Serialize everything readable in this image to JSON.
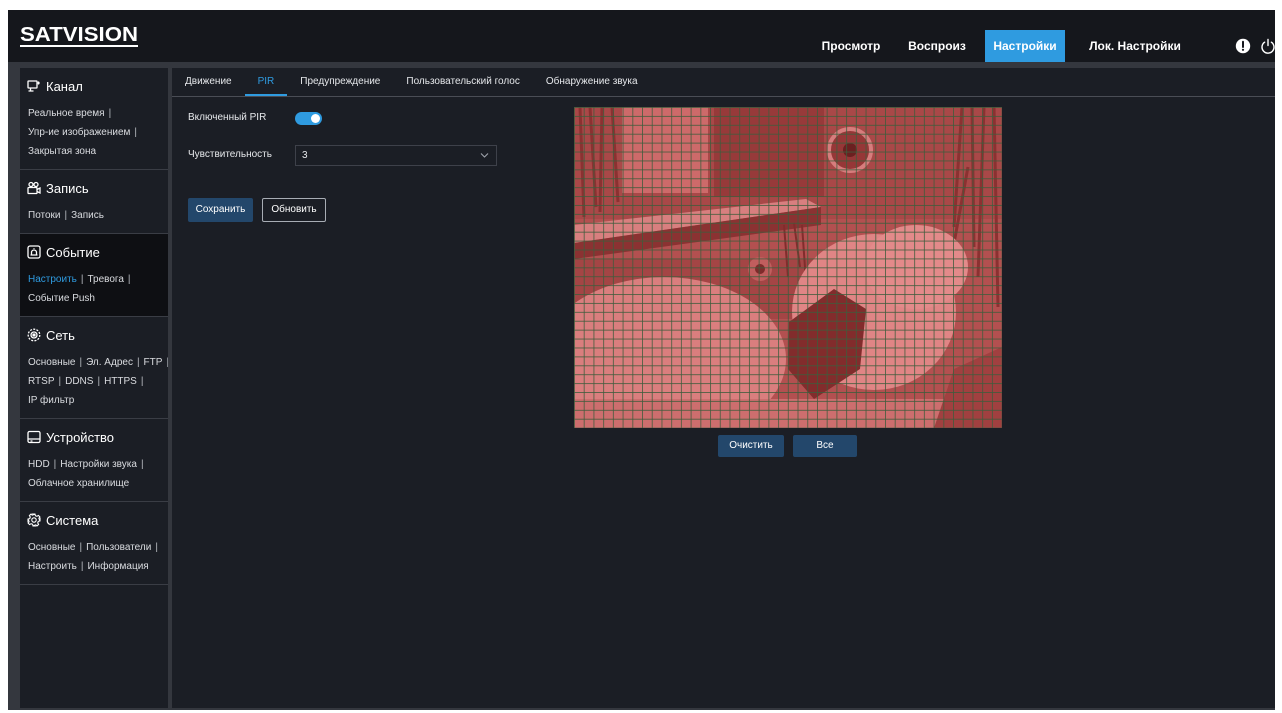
{
  "header": {
    "logo": "SATVISION",
    "nav": [
      {
        "label": "Просмотр",
        "active": false
      },
      {
        "label": "Воспроиз",
        "active": false
      },
      {
        "label": "Настройки",
        "active": true
      },
      {
        "label": "Лок. Настройки",
        "active": false
      }
    ],
    "icons": [
      "alert-icon",
      "power-icon"
    ]
  },
  "sidebar": {
    "separator": "|",
    "sections": [
      {
        "title": "Канал",
        "icon": "monitor-icon",
        "active": false,
        "lines": [
          [
            "Реальное время"
          ],
          [
            "Упр-ие изображением"
          ],
          [
            "Закрытая зона"
          ]
        ]
      },
      {
        "title": "Запись",
        "icon": "camera-icon",
        "active": false,
        "lines": [
          [
            "Потоки",
            "Запись"
          ]
        ]
      },
      {
        "title": "Событие",
        "icon": "alarm-icon",
        "active": true,
        "selected": "Настроить",
        "lines": [
          [
            "Настроить",
            "Тревога"
          ],
          [
            "Событие Push"
          ]
        ]
      },
      {
        "title": "Сеть",
        "icon": "network-icon",
        "active": false,
        "lines": [
          [
            "Основные",
            "Эл. Адрес",
            "FTP"
          ],
          [
            "RTSP",
            "DDNS",
            "HTTPS"
          ],
          [
            "IP фильтр"
          ]
        ]
      },
      {
        "title": "Устройство",
        "icon": "hdd-icon",
        "active": false,
        "lines": [
          [
            "HDD",
            "Настройки звука"
          ],
          [
            "Облачное хранилище"
          ]
        ]
      },
      {
        "title": "Система",
        "icon": "gear-icon",
        "active": false,
        "lines": [
          [
            "Основные",
            "Пользователи"
          ],
          [
            "Настроить",
            "Информация"
          ]
        ]
      }
    ]
  },
  "tabs": [
    {
      "label": "Движение",
      "active": false
    },
    {
      "label": "PIR",
      "active": true
    },
    {
      "label": "Предупреждение",
      "active": false
    },
    {
      "label": "Пользовательский голос",
      "active": false
    },
    {
      "label": "Обнаружение звука",
      "active": false
    }
  ],
  "form": {
    "pir_label": "Включенный PIR",
    "pir_enabled": true,
    "sensitivity_label": "Чувствительность",
    "sensitivity_value": "3",
    "save_label": "Сохранить",
    "refresh_label": "Обновить"
  },
  "video": {
    "clear_label": "Очистить",
    "all_label": "Все"
  },
  "colors": {
    "accent": "#2f9be0",
    "button": "#23476b",
    "background": "#1b1e25",
    "header": "#15171c",
    "active_section": "#0e0f13"
  }
}
